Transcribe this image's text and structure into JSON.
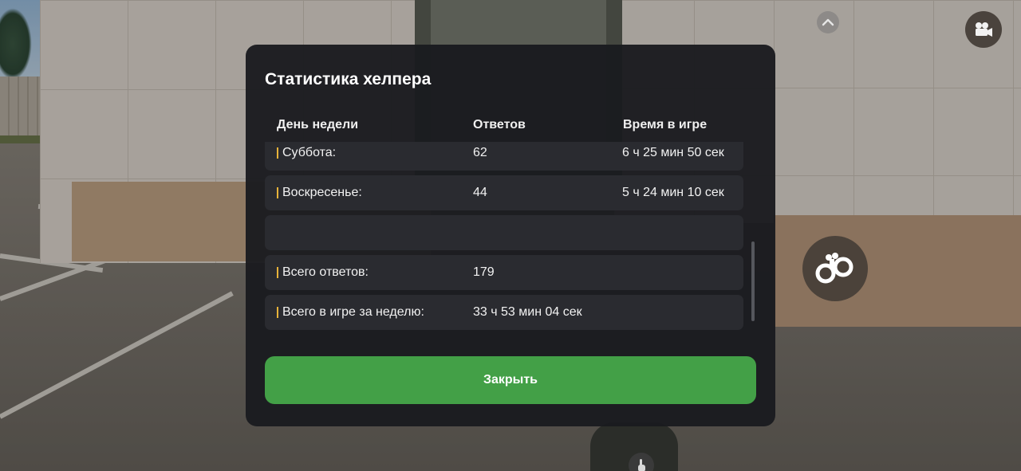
{
  "hud": {
    "scroll_up_icon": "chevron-up-icon",
    "camera_icon": "video-camera-icon",
    "handcuffs_icon": "handcuffs-icon",
    "touch_icon": "hand-pointer-icon"
  },
  "modal": {
    "title": "Статистика хелпера",
    "columns": {
      "day": "День недели",
      "answers": "Ответов",
      "time": "Время в игре"
    },
    "rows": [
      {
        "day": "Суббота:",
        "answers": "62",
        "time": "6 ч 25 мин 50 сек"
      },
      {
        "day": "Воскресенье:",
        "answers": "44",
        "time": "5 ч 24 мин 10 сек"
      },
      {
        "day": "",
        "answers": "",
        "time": ""
      },
      {
        "day": "Всего ответов:",
        "answers": "179",
        "time": ""
      },
      {
        "day": "Всего в игре за неделю:",
        "answers": "33 ч 53 мин 04 сек",
        "time": ""
      }
    ],
    "close_label": "Закрыть"
  },
  "colors": {
    "accent_bar": "#e8b33a",
    "close_button": "#43a047",
    "modal_bg": "#1a1b1f",
    "row_bg": "#2a2b30"
  }
}
